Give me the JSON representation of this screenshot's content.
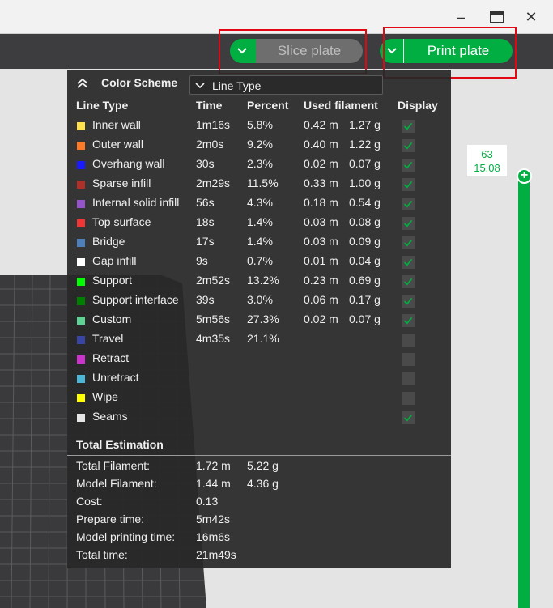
{
  "window": {
    "minimize_glyph": "–",
    "close_glyph": "✕"
  },
  "toolbar": {
    "slice_label": "Slice plate",
    "print_label": "Print plate"
  },
  "legend": {
    "scheme_title": "Color Scheme",
    "scheme_value": "Line Type",
    "columns": [
      "Line Type",
      "Time",
      "Percent",
      "Used filament",
      "Display"
    ],
    "rows": [
      {
        "name": "Inner wall",
        "color": "#ffe14d",
        "time": "1m16s",
        "percent": "5.8%",
        "len": "0.42 m",
        "wt": "1.27 g",
        "display": true
      },
      {
        "name": "Outer wall",
        "color": "#ff7a26",
        "time": "2m0s",
        "percent": "9.2%",
        "len": "0.40 m",
        "wt": "1.22 g",
        "display": true
      },
      {
        "name": "Overhang wall",
        "color": "#1a1aff",
        "time": "30s",
        "percent": "2.3%",
        "len": "0.02 m",
        "wt": "0.07 g",
        "display": true
      },
      {
        "name": "Sparse infill",
        "color": "#b03029",
        "time": "2m29s",
        "percent": "11.5%",
        "len": "0.33 m",
        "wt": "1.00 g",
        "display": true
      },
      {
        "name": "Internal solid infill",
        "color": "#9654cc",
        "time": "56s",
        "percent": "4.3%",
        "len": "0.18 m",
        "wt": "0.54 g",
        "display": true
      },
      {
        "name": "Top surface",
        "color": "#f23535",
        "time": "18s",
        "percent": "1.4%",
        "len": "0.03 m",
        "wt": "0.08 g",
        "display": true
      },
      {
        "name": "Bridge",
        "color": "#4d80ba",
        "time": "17s",
        "percent": "1.4%",
        "len": "0.03 m",
        "wt": "0.09 g",
        "display": true
      },
      {
        "name": "Gap infill",
        "color": "#ffffff",
        "time": "9s",
        "percent": "0.7%",
        "len": "0.01 m",
        "wt": "0.04 g",
        "display": true
      },
      {
        "name": "Support",
        "color": "#00ff00",
        "time": "2m52s",
        "percent": "13.2%",
        "len": "0.23 m",
        "wt": "0.69 g",
        "display": true
      },
      {
        "name": "Support interface",
        "color": "#008000",
        "time": "39s",
        "percent": "3.0%",
        "len": "0.06 m",
        "wt": "0.17 g",
        "display": true
      },
      {
        "name": "Custom",
        "color": "#5ed194",
        "time": "5m56s",
        "percent": "27.3%",
        "len": "0.02 m",
        "wt": "0.07 g",
        "display": true
      },
      {
        "name": "Travel",
        "color": "#3845a5",
        "time": "4m35s",
        "percent": "21.1%",
        "len": "",
        "wt": "",
        "display": false
      },
      {
        "name": "Retract",
        "color": "#cc33cc",
        "time": "",
        "percent": "",
        "len": "",
        "wt": "",
        "display": false
      },
      {
        "name": "Unretract",
        "color": "#4bb6d6",
        "time": "",
        "percent": "",
        "len": "",
        "wt": "",
        "display": false
      },
      {
        "name": "Wipe",
        "color": "#ffff00",
        "time": "",
        "percent": "",
        "len": "",
        "wt": "",
        "display": false
      },
      {
        "name": "Seams",
        "color": "#e6e6e6",
        "time": "",
        "percent": "",
        "len": "",
        "wt": "",
        "display": true
      }
    ],
    "total": {
      "title": "Total Estimation",
      "items": [
        {
          "label": "Total Filament:",
          "v1": "1.72 m",
          "v2": "5.22 g"
        },
        {
          "label": "Model Filament:",
          "v1": "1.44 m",
          "v2": "4.36 g"
        },
        {
          "label": "Cost:",
          "v1": "0.13",
          "v2": ""
        },
        {
          "label": "Prepare time:",
          "v1": "5m42s",
          "v2": ""
        },
        {
          "label": "Model printing time:",
          "v1": "16m6s",
          "v2": ""
        },
        {
          "label": "Total time:",
          "v1": "21m49s",
          "v2": ""
        }
      ]
    }
  },
  "slider": {
    "layer": "63",
    "height": "15.08",
    "handle_glyph": "+"
  },
  "colors": {
    "accent": "#00ae42",
    "highlight": "#e30613",
    "panel": "#282828"
  }
}
